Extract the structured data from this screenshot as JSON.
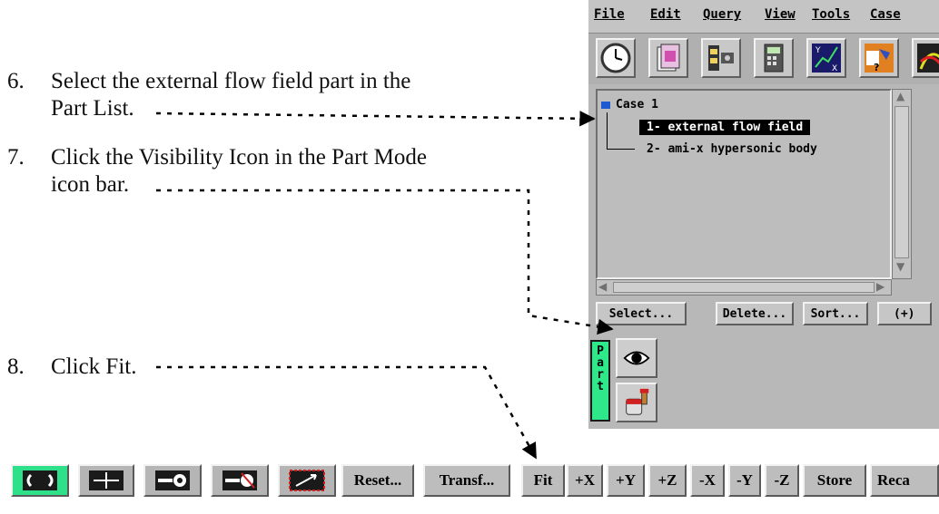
{
  "steps": [
    {
      "num": "6.",
      "line1": "Select the external flow field part in the",
      "line2": "Part List."
    },
    {
      "num": "7.",
      "line1": "Click the Visibility Icon in the Part Mode",
      "line2": "icon bar."
    },
    {
      "num": "8.",
      "line1": "Click Fit."
    }
  ],
  "menu": [
    "File",
    "Edit",
    "Query",
    "View",
    "Tools",
    "Case"
  ],
  "toolbar_icons": [
    "clock-icon",
    "file-icon",
    "filmstrip-icon",
    "calculator-icon",
    "plotter-icon",
    "help-icon",
    "chart-icon"
  ],
  "part_list": {
    "case_label": "Case 1",
    "items": [
      {
        "label": "1- external flow field",
        "selected": true
      },
      {
        "label": "2- ami-x hypersonic body",
        "selected": false
      }
    ]
  },
  "part_buttons": [
    "Select...",
    "Delete...",
    "Sort...",
    "(+)"
  ],
  "part_tab": [
    "P",
    "a",
    "r",
    "t"
  ],
  "mode_icons": [
    "eye-icon",
    "paint-bucket-icon"
  ],
  "bottom_bar": {
    "icon_buttons": [
      "rotate-icon",
      "translate-icon",
      "zoom-icon",
      "zoom-region-icon",
      "look-at-icon"
    ],
    "labels": [
      "Reset...",
      "Transf...",
      "Fit",
      "+X",
      "+Y",
      "+Z",
      "-X",
      "-Y",
      "-Z",
      "Store",
      "Reca"
    ]
  },
  "colors": {
    "selection": "#000000",
    "part_tab": "#2ee88a",
    "case_marker": "#1e5bd0"
  }
}
